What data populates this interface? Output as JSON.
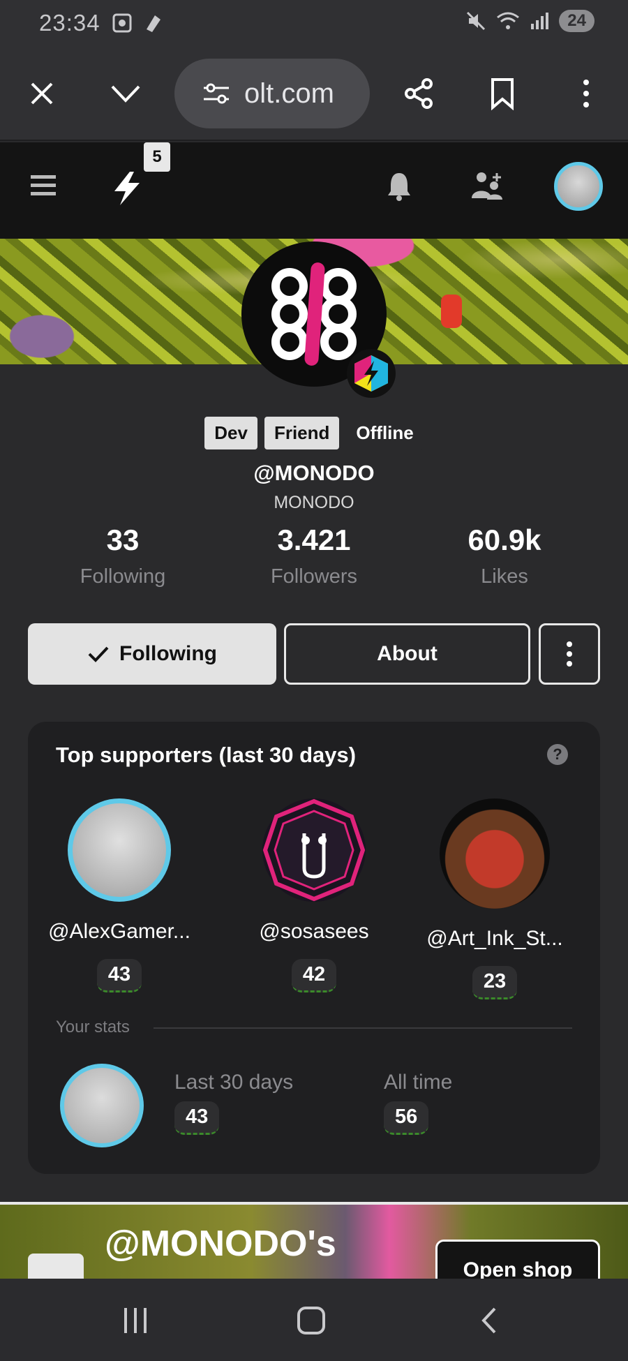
{
  "status_bar": {
    "time": "23:34",
    "battery": "24"
  },
  "browser": {
    "url": "olt.com"
  },
  "app_header": {
    "notification_count": "5"
  },
  "profile": {
    "tags": [
      "Dev",
      "Friend",
      "Offline"
    ],
    "handle": "@MONODO",
    "display_name": "MONODO",
    "stats": [
      {
        "value": "33",
        "label": "Following"
      },
      {
        "value": "3.421",
        "label": "Followers"
      },
      {
        "value": "60.9k",
        "label": "Likes"
      }
    ]
  },
  "actions": {
    "following_label": "Following",
    "about_label": "About"
  },
  "supporters": {
    "title": "Top supporters (last 30 days)",
    "help": "?",
    "items": [
      {
        "name": "@AlexGamer...",
        "score": "43"
      },
      {
        "name": "@sosasees",
        "score": "42"
      },
      {
        "name": "@Art_Ink_St...",
        "score": "23"
      }
    ],
    "your_stats_label": "Your stats",
    "last30_label": "Last 30 days",
    "last30_value": "43",
    "alltime_label": "All time",
    "alltime_value": "56"
  },
  "shop": {
    "title": "@MONODO's",
    "button": "Open shop"
  },
  "icons": {
    "close": "close-icon",
    "chevron": "chevron-down-icon",
    "share": "share-icon",
    "bookmark": "bookmark-icon",
    "menu": "menu-icon",
    "bolt": "bolt-icon",
    "bell": "bell-icon",
    "add_friend": "add-friend-icon"
  },
  "colors": {
    "accent_cyan": "#5fc9e8",
    "pink": "#e0237b",
    "green": "#3b8a2a"
  }
}
